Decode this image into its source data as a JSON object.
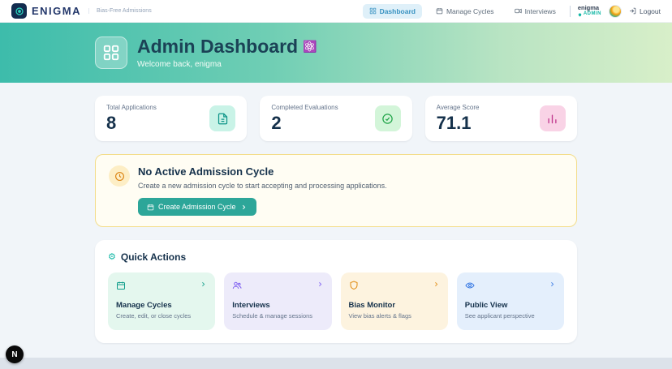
{
  "navbar": {
    "brand": "ENIGMA",
    "tagline": "Bias-Free Admissions",
    "nav": [
      {
        "label": "Dashboard"
      },
      {
        "label": "Manage Cycles"
      },
      {
        "label": "Interviews"
      }
    ],
    "user_name": "enigma",
    "user_role": "ADMIN",
    "logout_label": "Logout"
  },
  "hero": {
    "title": "Admin Dashboard",
    "emoji": "⚛️",
    "subtitle": "Welcome back, enigma"
  },
  "stats": [
    {
      "label": "Total Applications",
      "value": "8",
      "icon": "document-icon"
    },
    {
      "label": "Completed Evaluations",
      "value": "2",
      "icon": "check-circle-icon"
    },
    {
      "label": "Average Score",
      "value": "71.1",
      "icon": "bar-chart-icon"
    }
  ],
  "alert": {
    "title": "No Active Admission Cycle",
    "description": "Create a new admission cycle to start accepting and processing applications.",
    "button_label": "Create Admission Cycle"
  },
  "quick_actions": {
    "icon": "⚙",
    "title": "Quick Actions",
    "cards": [
      {
        "title": "Manage Cycles",
        "description": "Create, edit, or close cycles",
        "icon": "calendar-icon"
      },
      {
        "title": "Interviews",
        "description": "Schedule & manage sessions",
        "icon": "users-icon"
      },
      {
        "title": "Bias Monitor",
        "description": "View bias alerts & flags",
        "icon": "shield-icon"
      },
      {
        "title": "Public View",
        "description": "See applicant perspective",
        "icon": "eye-icon"
      }
    ]
  },
  "colors": {
    "accent_teal": "#14b8a6",
    "navy": "#15314b",
    "alert_border": "#f3dd8a"
  },
  "dev_badge": "N"
}
